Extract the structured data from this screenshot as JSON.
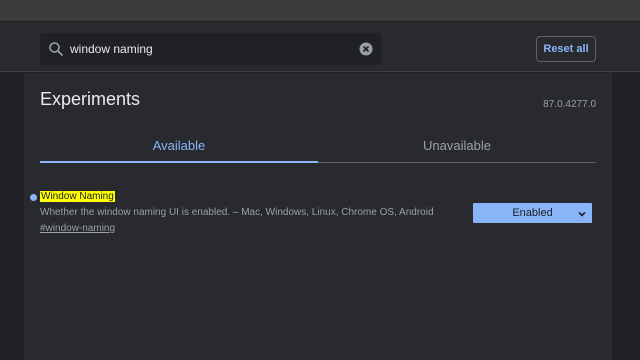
{
  "search": {
    "value": "window naming",
    "icon": "search-icon",
    "clear_icon": "clear-icon"
  },
  "header": {
    "reset_label": "Reset all"
  },
  "main": {
    "title": "Experiments",
    "version": "87.0.4277.0",
    "tabs": [
      {
        "label": "Available",
        "active": true
      },
      {
        "label": "Unavailable",
        "active": false
      }
    ]
  },
  "flags": [
    {
      "name": "Window Naming",
      "description": "Whether the window naming UI is enabled. – Mac, Windows, Linux, Chrome OS, Android",
      "link": "#window-naming",
      "selected": "Enabled"
    }
  ],
  "colors": {
    "accent": "#8ab4f8",
    "highlight": "#ffff00",
    "background": "#292a2d"
  }
}
